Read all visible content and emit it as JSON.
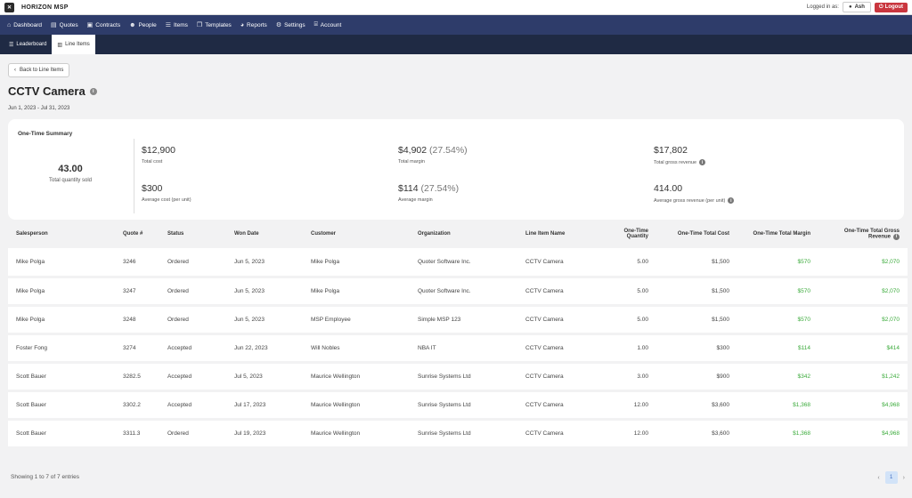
{
  "app": {
    "brand": "HORIZON MSP",
    "logged_in_label": "Logged in as:",
    "user": "Ash",
    "logout": "Logout"
  },
  "nav": [
    {
      "label": "Dashboard",
      "icon": "home-icon"
    },
    {
      "label": "Quotes",
      "icon": "document-icon"
    },
    {
      "label": "Contracts",
      "icon": "contract-icon"
    },
    {
      "label": "People",
      "icon": "people-icon"
    },
    {
      "label": "Items",
      "icon": "list-icon"
    },
    {
      "label": "Templates",
      "icon": "templates-icon"
    },
    {
      "label": "Reports",
      "icon": "pie-chart-icon"
    },
    {
      "label": "Settings",
      "icon": "gear-icon"
    },
    {
      "label": "Account",
      "icon": "bank-icon"
    }
  ],
  "subnav": [
    {
      "label": "Leaderboard",
      "active": false
    },
    {
      "label": "Line Items",
      "active": true
    }
  ],
  "back_label": "Back to Line Items",
  "title": "CCTV Camera",
  "date_range": "Jun 1, 2023 - Jul 31, 2023",
  "summary": {
    "title": "One-Time Summary",
    "qty_value": "43.00",
    "qty_label": "Total quantity sold",
    "total_cost": "$12,900",
    "total_cost_label": "Total cost",
    "total_margin": "$4,902",
    "total_margin_pct": "(27.54%)",
    "total_margin_label": "Total margin",
    "total_gross": "$17,802",
    "total_gross_label": "Total gross revenue",
    "avg_cost": "$300",
    "avg_cost_label": "Average cost (per unit)",
    "avg_margin": "$114",
    "avg_margin_pct": "(27.54%)",
    "avg_margin_label": "Average margin",
    "avg_gross": "414.00",
    "avg_gross_label": "Average gross revenue (per unit)"
  },
  "table": {
    "headers": [
      "Salesperson",
      "Quote #",
      "Status",
      "Won Date",
      "Customer",
      "Organization",
      "Line Item Name",
      "One-Time Quantity",
      "One-Time Total Cost",
      "One-Time Total Margin",
      "One-Time Total Gross Revenue"
    ],
    "rows": [
      [
        "Mike Polga",
        "3246",
        "Ordered",
        "Jun 5, 2023",
        "Mike Polga",
        "Quoter Software Inc.",
        "CCTV Camera",
        "5.00",
        "$1,500",
        "$570",
        "$2,070"
      ],
      [
        "Mike Polga",
        "3247",
        "Ordered",
        "Jun 5, 2023",
        "Mike Polga",
        "Quoter Software Inc.",
        "CCTV Camera",
        "5.00",
        "$1,500",
        "$570",
        "$2,070"
      ],
      [
        "Mike Polga",
        "3248",
        "Ordered",
        "Jun 5, 2023",
        "MSP Employee",
        "Simple MSP 123",
        "CCTV Camera",
        "5.00",
        "$1,500",
        "$570",
        "$2,070"
      ],
      [
        "Foster Fong",
        "3274",
        "Accepted",
        "Jun 22, 2023",
        "Will Nobles",
        "NBA IT",
        "CCTV Camera",
        "1.00",
        "$300",
        "$114",
        "$414"
      ],
      [
        "Scott Bauer",
        "3282.5",
        "Accepted",
        "Jul 5, 2023",
        "Maurice Wellington",
        "Sunrise Systems Ltd",
        "CCTV Camera",
        "3.00",
        "$900",
        "$342",
        "$1,242"
      ],
      [
        "Scott Bauer",
        "3302.2",
        "Accepted",
        "Jul 17, 2023",
        "Maurice Wellington",
        "Sunrise Systems Ltd",
        "CCTV Camera",
        "12.00",
        "$3,600",
        "$1,368",
        "$4,968"
      ],
      [
        "Scott Bauer",
        "3311.3",
        "Ordered",
        "Jul 19, 2023",
        "Maurice Wellington",
        "Sunrise Systems Ltd",
        "CCTV Camera",
        "12.00",
        "$3,600",
        "$1,368",
        "$4,968"
      ]
    ]
  },
  "footer": "Showing 1 to 7 of 7 entries",
  "pager": {
    "current": "1"
  },
  "colors": {
    "nav": "#2e3c6a",
    "subnav": "#1f2a44",
    "positive": "#3cab3c",
    "logout": "#c9363e"
  }
}
